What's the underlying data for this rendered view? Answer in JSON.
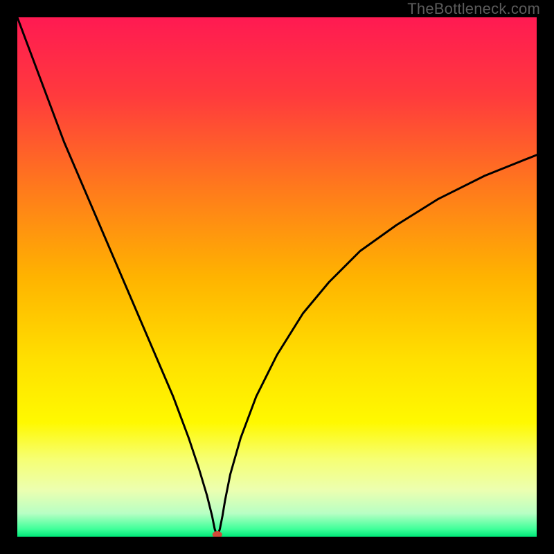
{
  "watermark": "TheBottleneck.com",
  "chart_data": {
    "type": "line",
    "title": "",
    "xlabel": "",
    "ylabel": "",
    "xlim": [
      0,
      100
    ],
    "ylim": [
      0,
      100
    ],
    "grid": false,
    "axis_ticks_visible": false,
    "background": {
      "type": "vertical-gradient",
      "description": "red at top through orange/yellow to green at bottom",
      "stops": [
        {
          "offset": 0.0,
          "color": "#ff1a52"
        },
        {
          "offset": 0.15,
          "color": "#ff3a3d"
        },
        {
          "offset": 0.33,
          "color": "#ff7a1c"
        },
        {
          "offset": 0.5,
          "color": "#ffb300"
        },
        {
          "offset": 0.66,
          "color": "#ffe000"
        },
        {
          "offset": 0.78,
          "color": "#fff900"
        },
        {
          "offset": 0.85,
          "color": "#f6ff73"
        },
        {
          "offset": 0.91,
          "color": "#ecffb0"
        },
        {
          "offset": 0.955,
          "color": "#b8ffc4"
        },
        {
          "offset": 0.985,
          "color": "#40ff9a"
        },
        {
          "offset": 1.0,
          "color": "#00e878"
        }
      ]
    },
    "minimum_marker": {
      "x": 38.5,
      "y": 0,
      "color": "#d24a3a"
    },
    "series": [
      {
        "name": "bottleneck-curve",
        "color": "#000000",
        "stroke_width": 3,
        "x": [
          0,
          3,
          6,
          9,
          12,
          15,
          18,
          21,
          24,
          27,
          30,
          33,
          35,
          36.5,
          37.5,
          38,
          38.5,
          39,
          39.5,
          40,
          41,
          43,
          46,
          50,
          55,
          60,
          66,
          73,
          81,
          90,
          100
        ],
        "y": [
          100,
          92,
          84,
          76,
          69,
          62,
          55,
          48,
          41,
          34,
          27,
          19,
          13,
          8,
          4,
          1.5,
          0,
          1.5,
          4,
          7,
          12,
          19,
          27,
          35,
          43,
          49,
          55,
          60,
          65,
          69.5,
          73.5
        ]
      }
    ]
  }
}
